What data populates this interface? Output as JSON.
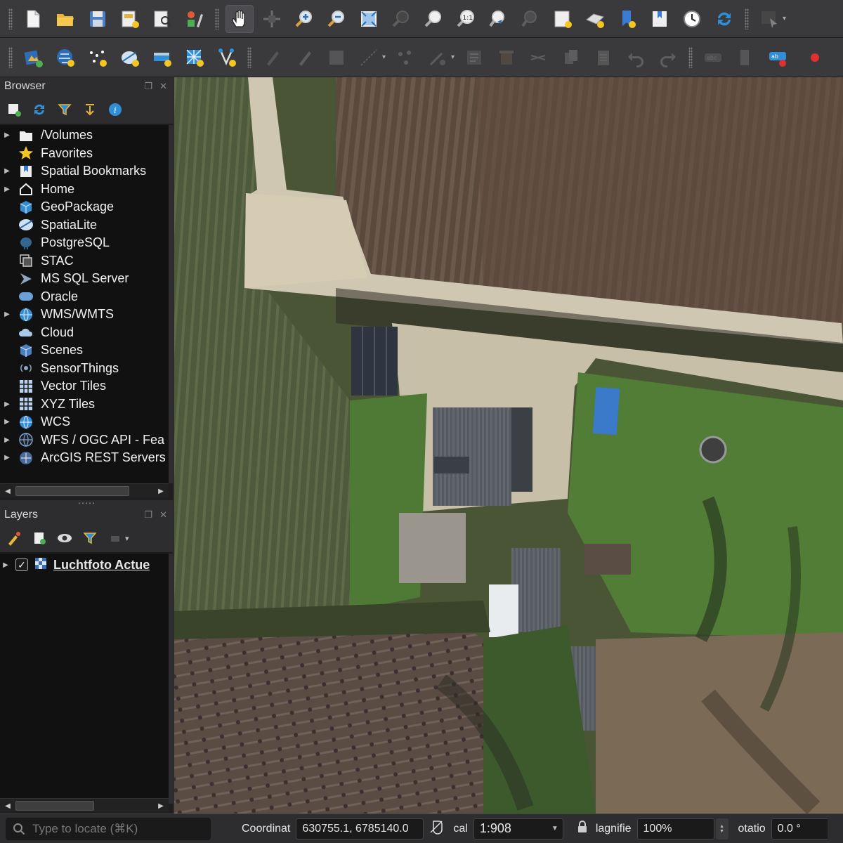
{
  "toolbar1": {
    "icons": [
      "new-project-icon",
      "open-project-icon",
      "save-project-icon",
      "new-print-layout-icon",
      "layout-manager-icon",
      "style-manager-icon",
      "pan-icon",
      "pan-to-selection-icon",
      "zoom-in-icon",
      "zoom-out-icon",
      "zoom-full-icon",
      "zoom-to-selection-icon",
      "zoom-to-layer-icon",
      "zoom-native-icon",
      "zoom-last-icon",
      "zoom-next-icon",
      "new-map-view-icon",
      "new-3d-map-view-icon",
      "new-bookmark-icon",
      "show-bookmarks-icon",
      "temporal-controller-icon",
      "refresh-icon",
      "identify-icon"
    ]
  },
  "toolbar2": {
    "icons": [
      "data-source-manager-icon",
      "new-geopackage-layer-icon",
      "new-temporary-layer-icon",
      "new-spatialite-layer-icon",
      "new-virtual-layer-icon",
      "new-mesh-layer-icon",
      "new-gps-layer-icon",
      "current-edits-icon",
      "toggle-editing-icon",
      "save-edits-icon",
      "digitize-icon",
      "vertex-tool-icon",
      "modify-attributes-icon",
      "delete-selected-icon",
      "cut-features-icon",
      "copy-features-icon",
      "paste-features-icon",
      "undo-icon",
      "redo-icon",
      "label-toolbar-icon",
      "pin-label-icon",
      "label-highlight-icon"
    ]
  },
  "browser": {
    "title": "Browser",
    "items": [
      {
        "label": "/Volumes",
        "icon": "folder-icon",
        "expandable": true
      },
      {
        "label": "Favorites",
        "icon": "star-icon",
        "expandable": false
      },
      {
        "label": "Spatial Bookmarks",
        "icon": "bookmark-icon",
        "expandable": true
      },
      {
        "label": "Home",
        "icon": "home-icon",
        "expandable": true
      },
      {
        "label": "GeoPackage",
        "icon": "geopackage-icon",
        "expandable": false
      },
      {
        "label": "SpatiaLite",
        "icon": "spatialite-icon",
        "expandable": false
      },
      {
        "label": "PostgreSQL",
        "icon": "postgresql-icon",
        "expandable": false
      },
      {
        "label": "STAC",
        "icon": "stac-icon",
        "expandable": false
      },
      {
        "label": "MS SQL Server",
        "icon": "mssql-icon",
        "expandable": false
      },
      {
        "label": "Oracle",
        "icon": "oracle-icon",
        "expandable": false
      },
      {
        "label": "WMS/WMTS",
        "icon": "wms-icon",
        "expandable": true
      },
      {
        "label": "Cloud",
        "icon": "cloud-icon",
        "expandable": false
      },
      {
        "label": "Scenes",
        "icon": "scenes-icon",
        "expandable": false
      },
      {
        "label": "SensorThings",
        "icon": "sensorthings-icon",
        "expandable": false
      },
      {
        "label": "Vector Tiles",
        "icon": "vector-tiles-icon",
        "expandable": false
      },
      {
        "label": "XYZ Tiles",
        "icon": "xyz-tiles-icon",
        "expandable": true
      },
      {
        "label": "WCS",
        "icon": "wcs-icon",
        "expandable": true
      },
      {
        "label": "WFS / OGC API - Fea",
        "icon": "wfs-icon",
        "expandable": true
      },
      {
        "label": "ArcGIS REST Servers",
        "icon": "arcgis-icon",
        "expandable": true
      }
    ]
  },
  "layers": {
    "title": "Layers",
    "items": [
      {
        "label": "Luchtfoto Actue",
        "checked": true
      }
    ]
  },
  "status": {
    "locator_placeholder": "Type to locate (⌘K)",
    "coordinate_label": "Coordinat",
    "coordinate_value": "630755.1, 6785140.0",
    "scale_label": "cal",
    "scale_value": "1:908",
    "magnifier_label": "lagnifie",
    "magnifier_value": "100%",
    "rotation_label": "otatio",
    "rotation_value": "0.0 °"
  },
  "colors": {
    "accent": "#2f8fd8",
    "panel_bg": "#1e1e1e",
    "toolbar_bg": "#3a3a3c"
  }
}
